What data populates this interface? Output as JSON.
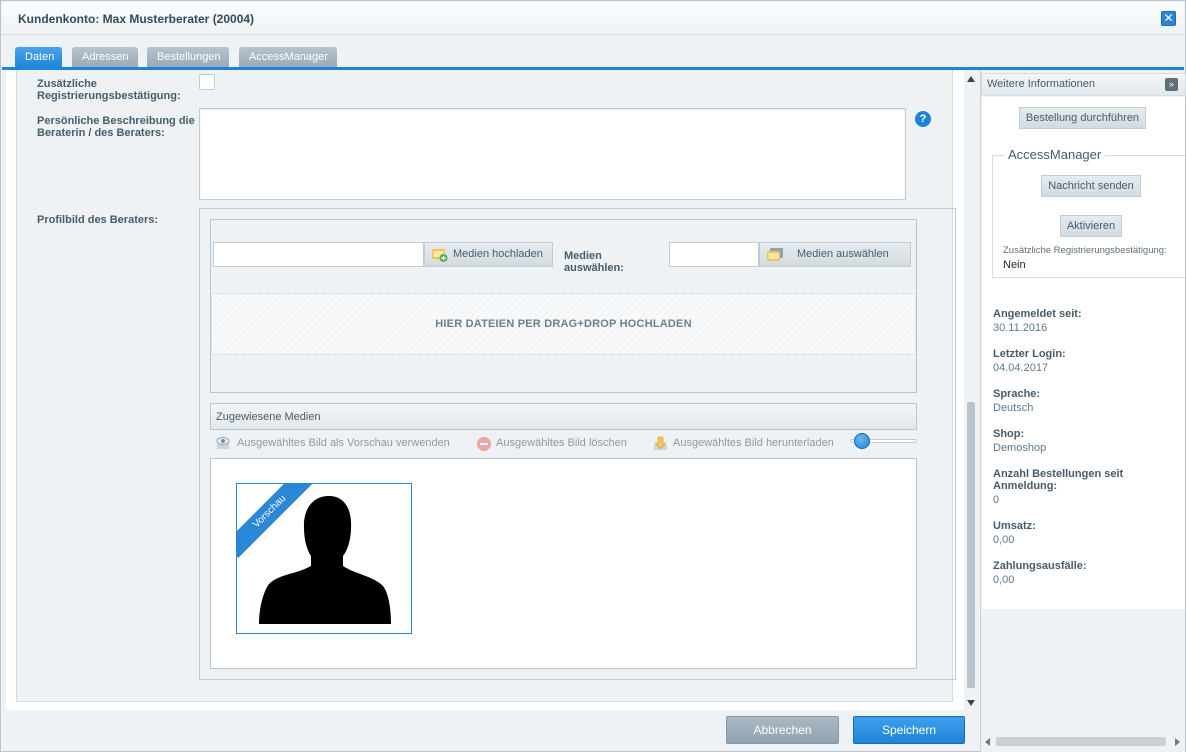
{
  "window": {
    "title": "Kundenkonto: Max Musterberater (20004)"
  },
  "tabs": [
    {
      "label": "Daten",
      "active": true
    },
    {
      "label": "Adressen",
      "active": false
    },
    {
      "label": "Bestellungen",
      "active": false
    },
    {
      "label": "AccessManager",
      "active": false
    }
  ],
  "form": {
    "extra_confirmation_label": "Zusätzliche Registrierungsbestätigung:",
    "description_label": "Persönliche Beschreibung die Beraterin / des Beraters:",
    "description_value": "",
    "profile_image_label": "Profilbild des Beraters:",
    "help_icon": "?"
  },
  "media": {
    "upload_input_value": "",
    "upload_button": "Medien hochladen",
    "select_label": "Medien auswählen:",
    "select_input_value": "",
    "select_button": "Medien auswählen",
    "dropzone_text": "HIER DATEIEN PER DRAG+DROP HOCHLADEN",
    "assigned_title": "Zugewiesene Medien",
    "toolbar": {
      "preview": "Ausgewähltes Bild als Vorschau verwenden",
      "delete": "Ausgewähltes Bild löschen",
      "download": "Ausgewähltes Bild herunterladen"
    },
    "thumbnail_ribbon": "Vorschau"
  },
  "sidebar": {
    "title": "Weitere Informationen",
    "order_button": "Bestellung durchführen",
    "access_manager": {
      "legend": "AccessManager",
      "send_message_button": "Nachricht senden",
      "activate_button": "Aktivieren",
      "extra_confirmation_label": "Zusätzliche Registrierungsbestätigung:",
      "extra_confirmation_value": "Nein"
    },
    "info": [
      {
        "label": "Angemeldet seit:",
        "value": "30.11.2016"
      },
      {
        "label": "Letzter Login:",
        "value": "04.04.2017"
      },
      {
        "label": "Sprache:",
        "value": "Deutsch"
      },
      {
        "label": "Shop:",
        "value": "Demoshop"
      },
      {
        "label": "Anzahl Bestellungen seit Anmeldung:",
        "value": "0"
      },
      {
        "label": "Umsatz:",
        "value": "0,00"
      },
      {
        "label": "Zahlungsausfälle:",
        "value": "0,00"
      }
    ]
  },
  "footer": {
    "cancel_button": "Abbrechen",
    "save_button": "Speichern"
  },
  "colors": {
    "accent": "#1f84d8",
    "tab_inactive": "#a3b1bc",
    "cancel": "#9aabb8"
  }
}
